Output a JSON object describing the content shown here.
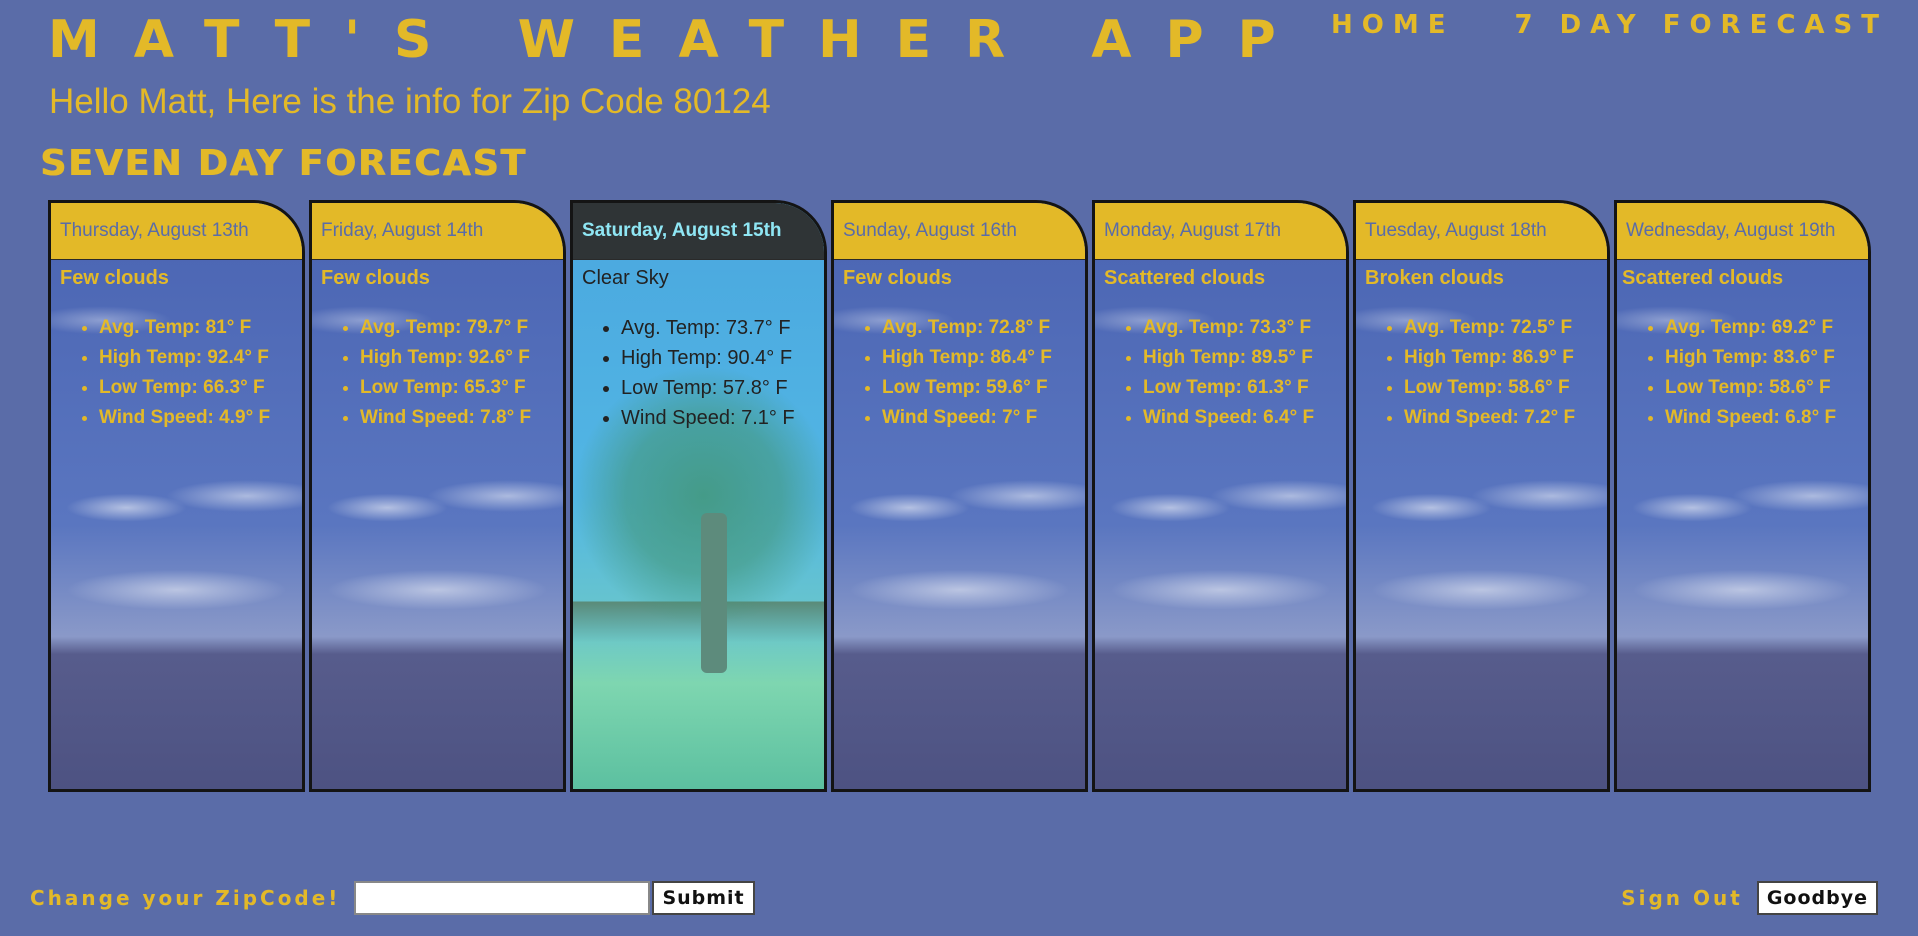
{
  "app": {
    "title": "MATT'S WEATHER APP",
    "greeting": "Hello Matt, Here is the info for Zip Code 80124"
  },
  "nav": {
    "home": "HOME",
    "forecast": "7 DAY FORECAST"
  },
  "section_title": "SEVEN DAY FORECAST",
  "colors": {
    "background": "#5a6ca8",
    "accent": "#e3b928",
    "highlight_header": "#2f3436",
    "highlight_text": "#8fe6f4"
  },
  "days": [
    {
      "date": "Thursday, August 13th",
      "description": "Few clouds",
      "avg": "Avg. Temp: 81° F",
      "high": "High Temp: 92.4° F",
      "low": "Low Temp: 66.3° F",
      "wind": "Wind Speed: 4.9° F"
    },
    {
      "date": "Friday, August 14th",
      "description": "Few clouds",
      "avg": "Avg. Temp: 79.7° F",
      "high": "High Temp: 92.6° F",
      "low": "Low Temp: 65.3° F",
      "wind": "Wind Speed: 7.8° F"
    },
    {
      "date": "Saturday, August 15th",
      "description": "Clear Sky",
      "avg": "Avg. Temp: 73.7° F",
      "high": "High Temp: 90.4° F",
      "low": "Low Temp: 57.8° F",
      "wind": "Wind Speed: 7.1° F"
    },
    {
      "date": "Sunday, August 16th",
      "description": "Few clouds",
      "avg": "Avg. Temp: 72.8° F",
      "high": "High Temp: 86.4° F",
      "low": "Low Temp: 59.6° F",
      "wind": "Wind Speed: 7° F"
    },
    {
      "date": "Monday, August 17th",
      "description": "Scattered clouds",
      "avg": "Avg. Temp: 73.3° F",
      "high": "High Temp: 89.5° F",
      "low": "Low Temp: 61.3° F",
      "wind": "Wind Speed: 6.4° F"
    },
    {
      "date": "Tuesday, August 18th",
      "description": "Broken clouds",
      "avg": "Avg. Temp: 72.5° F",
      "high": "High Temp: 86.9° F",
      "low": "Low Temp: 58.6° F",
      "wind": "Wind Speed: 7.2° F"
    },
    {
      "date": "Wednesday, August 19th",
      "description": "Scattered clouds",
      "avg": "Avg. Temp: 69.2° F",
      "high": "High Temp: 83.6° F",
      "low": "Low Temp: 58.6° F",
      "wind": "Wind Speed: 6.8° F"
    }
  ],
  "footer": {
    "zip_label": "Change your ZipCode!",
    "zip_value": "",
    "zip_placeholder": "",
    "submit_label": "Submit",
    "signout_label": "Sign Out",
    "goodbye_label": "Goodbye"
  }
}
